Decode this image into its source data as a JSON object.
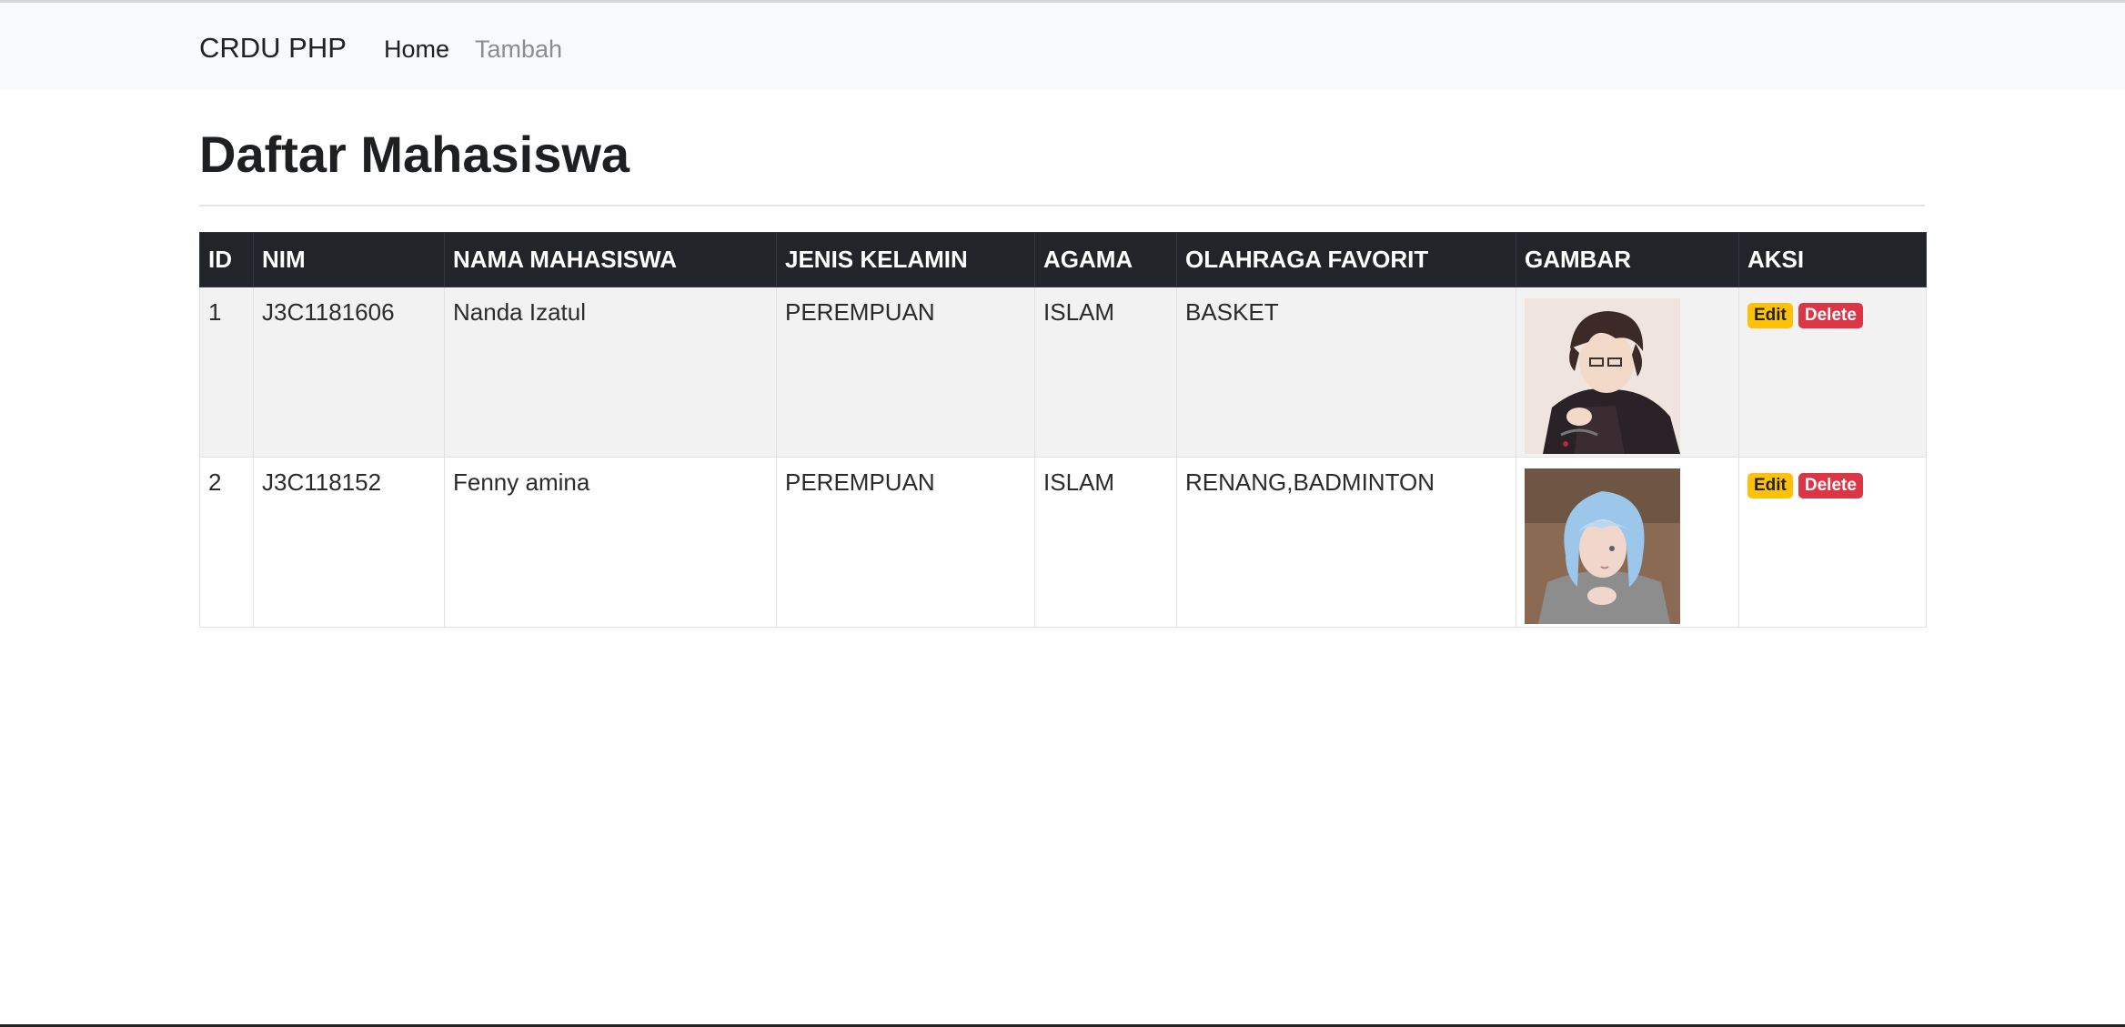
{
  "navbar": {
    "brand": "CRDU PHP",
    "links": [
      {
        "label": "Home"
      },
      {
        "label": "Tambah"
      }
    ]
  },
  "page": {
    "title": "Daftar Mahasiswa"
  },
  "table": {
    "headers": [
      "ID",
      "NIM",
      "NAMA MAHASISWA",
      "JENIS KELAMIN",
      "AGAMA",
      "OLAHRAGA FAVORIT",
      "GAMBAR",
      "AKSI"
    ],
    "rows": [
      {
        "id": "1",
        "nim": "J3C1181606",
        "nama": "Nanda Izatul",
        "jenis_kelamin": "PEREMPUAN",
        "agama": "ISLAM",
        "olahraga": "BASKET",
        "image": "anime-boy-dark-hair-glasses",
        "actions": {
          "edit": "Edit",
          "delete": "Delete"
        }
      },
      {
        "id": "2",
        "nim": "J3C118152",
        "nama": "Fenny amina",
        "jenis_kelamin": "PEREMPUAN",
        "agama": "ISLAM",
        "olahraga": "RENANG,BADMINTON",
        "image": "anime-girl-blue-hair",
        "actions": {
          "edit": "Edit",
          "delete": "Delete"
        }
      }
    ]
  },
  "colors": {
    "navbar_bg": "#f8f9fa",
    "table_header_bg": "#212529",
    "edit_badge": "#ffc107",
    "delete_badge": "#dc3545"
  }
}
